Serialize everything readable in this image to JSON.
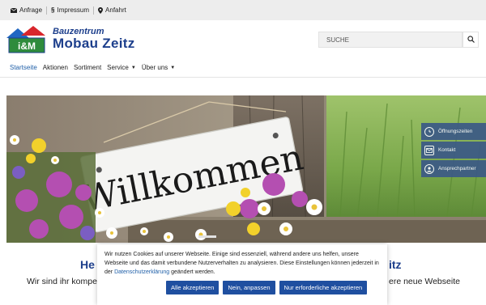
{
  "topbar": {
    "links": [
      {
        "label": "Anfrage",
        "icon": "envelope-icon"
      },
      {
        "label": "Impressum",
        "icon": "paragraph-icon"
      },
      {
        "label": "Anfahrt",
        "icon": "map-pin-icon"
      }
    ]
  },
  "header": {
    "logo_badge": "i&M",
    "brand_line1": "Bauzentrum",
    "brand_line2": "Mobau Zeitz",
    "search_placeholder": "SUCHE"
  },
  "nav": {
    "items": [
      {
        "label": "Startseite",
        "active": true,
        "dropdown": false
      },
      {
        "label": "Aktionen",
        "active": false,
        "dropdown": false
      },
      {
        "label": "Sortiment",
        "active": false,
        "dropdown": false
      },
      {
        "label": "Service",
        "active": false,
        "dropdown": true
      },
      {
        "label": "Über uns",
        "active": false,
        "dropdown": true
      }
    ]
  },
  "hero": {
    "sign_text": "Willkommen"
  },
  "side_buttons": [
    {
      "label": "Öffnungszeiten",
      "icon": "clock-icon"
    },
    {
      "label": "Kontakt",
      "icon": "envelope-icon"
    },
    {
      "label": "Ansprechpartner",
      "icon": "person-icon"
    }
  ],
  "below": {
    "headline_left": "He",
    "headline_right": "itz",
    "sub_left": "Wir sind ihr kompe",
    "sub_right": "ere neue Webseite"
  },
  "cookie": {
    "text_before_link": "Wir nutzen Cookies auf unserer Webseite. Einige sind essenziell, während andere uns helfen, unsere Webseite und das damit verbundene Nutzerverhalten zu analysieren. Diese Einstellungen können jederzeit in der ",
    "link_text": "Datenschutzerklärung",
    "text_after_link": " geändert werden.",
    "accept_all": "Alle akzeptieren",
    "customize": "Nein, anpassen",
    "essential_only": "Nur erforderliche akzeptieren"
  },
  "colors": {
    "brand_blue": "#1d3f8c",
    "button_blue": "#1f4fa0",
    "side_button": "#3c5a86",
    "topbar_bg": "#ededed"
  }
}
